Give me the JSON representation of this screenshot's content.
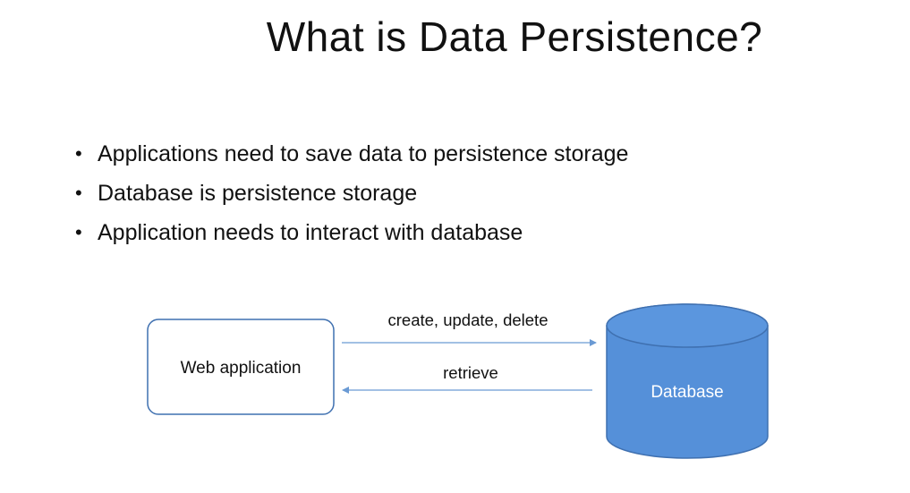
{
  "slide": {
    "title": "What is Data Persistence?",
    "bullets": [
      "Applications need to save data to persistence storage",
      "Database is persistence storage",
      "Application needs to interact with database"
    ]
  },
  "diagram": {
    "nodes": {
      "web_app": {
        "label": "Web application",
        "shape": "rounded-rectangle"
      },
      "database": {
        "label": "Database",
        "shape": "cylinder",
        "fill": "#5590d9",
        "stroke": "#3f70b0",
        "text_color": "#ffffff"
      }
    },
    "edges": [
      {
        "from": "web_app",
        "to": "database",
        "label": "create, update, delete"
      },
      {
        "from": "database",
        "to": "web_app",
        "label": "retrieve"
      }
    ],
    "arrow_color": "#6a9ad4"
  }
}
